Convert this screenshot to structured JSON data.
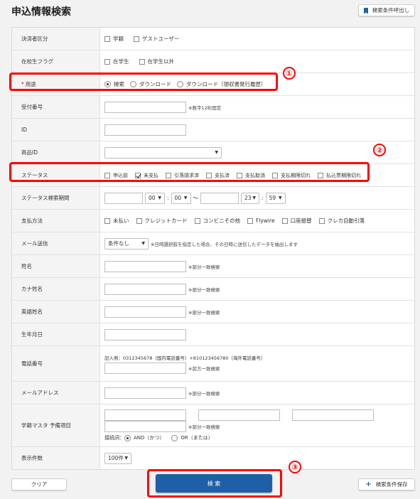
{
  "header": {
    "title": "申込情報検索",
    "load_conditions_label": "検索条件呼出し"
  },
  "fields": {
    "payer_type": {
      "label": "決済者区分",
      "options": [
        "学籍",
        "ゲストユーザー"
      ]
    },
    "enrollment": {
      "label": "在校生フラグ",
      "options": [
        "在学生",
        "在学生以外"
      ]
    },
    "purpose": {
      "required_mark": "*",
      "label": "用途",
      "options": [
        "検索",
        "ダウンロード",
        "ダウンロード（領収書発行履歴）"
      ],
      "selected": "検索"
    },
    "receipt_no": {
      "label": "受付番号",
      "note": "※数字12桁固定"
    },
    "id": {
      "label": "ID"
    },
    "product_id": {
      "label": "商品ID"
    },
    "status": {
      "label": "ステータス",
      "options": [
        "申込前",
        "未支払",
        "引落請求済",
        "支払済",
        "支払取消",
        "支払期限切れ",
        "払込票期限切れ"
      ],
      "checked": "未支払"
    },
    "status_period": {
      "label": "ステータス検索期間",
      "from_hour": "00",
      "from_min": "00",
      "sep": ":",
      "tilde": "～",
      "to_hour": "23",
      "to_min": "59"
    },
    "payment_method": {
      "label": "支払方法",
      "options": [
        "未払い",
        "クレジットカード",
        "コンビニその他",
        "Flywire",
        "口座振替",
        "クレカ自動引落"
      ]
    },
    "mail_sent": {
      "label": "メール送信",
      "value": "条件なし",
      "note": "※日時選択肢を指定した場合、その日時に送信したデータを抽出します"
    },
    "name": {
      "label": "姓名",
      "note": "※部分一致検索"
    },
    "kana_name": {
      "label": "カナ姓名",
      "note": "※部分一致検索"
    },
    "english_name": {
      "label": "英語姓名",
      "note": "※部分一致検索"
    },
    "birthdate": {
      "label": "生年月日"
    },
    "phone": {
      "label": "電話番号",
      "example": "記入例：0312345678（国内電話番号）+810123456780（海外電話番号）",
      "note": "※前方一致検索"
    },
    "email": {
      "label": "メールアドレス",
      "note": "※部分一致検索"
    },
    "student_master": {
      "label": "学籍マスタ 予備項目",
      "note": "※部分一致検索",
      "conn_label": "接続詞：",
      "and_label": "AND（かつ）",
      "or_label": "OR（または）",
      "selected": "AND"
    },
    "display_count": {
      "label": "表示件数",
      "value": "100件"
    }
  },
  "annotations": [
    "①",
    "②",
    "③"
  ],
  "footer": {
    "clear_label": "クリア",
    "search_label": "検 索",
    "save_label": "検索条件保存"
  },
  "colors": {
    "primary": "#1f5fa8",
    "highlight": "#ff0000"
  }
}
